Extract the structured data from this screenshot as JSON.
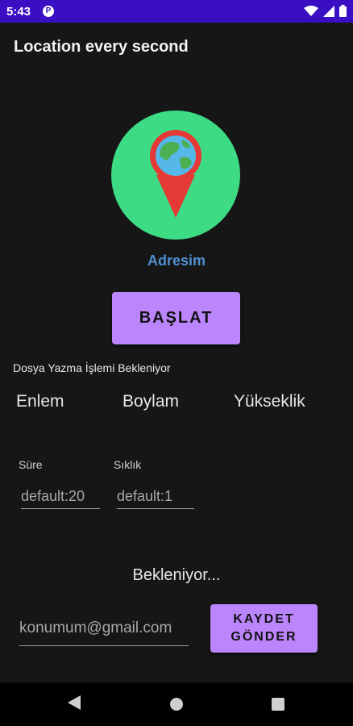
{
  "status_bar": {
    "time": "5:43",
    "app_icon_glyph": "P",
    "icons": [
      "wifi-icon",
      "signal-icon",
      "battery-icon"
    ],
    "background": "#3a0fc4"
  },
  "app_bar": {
    "title": "Location every second"
  },
  "logo": {
    "icon": "globe-map-pin-icon",
    "circle_color": "#3ddc84",
    "pin_color": "#e53935"
  },
  "address_label": "Adresim",
  "start_button": {
    "label": "BAŞLAT"
  },
  "file_status": "Dosya Yazma İşlemi Bekleniyor",
  "columns": {
    "latitude": "Enlem",
    "longitude": "Boylam",
    "altitude": "Yükseklik"
  },
  "duration": {
    "label": "Süre",
    "placeholder": "default:20"
  },
  "frequency": {
    "label": "Sıklık",
    "placeholder": "default:1"
  },
  "waiting_status": "Bekleniyor...",
  "email": {
    "placeholder": "konumum@gmail.com"
  },
  "save_button": {
    "line1": "KAYDET",
    "line2": "GÖNDER"
  },
  "accent_color": "#bb86fc",
  "nav_bar": {
    "buttons": [
      "back-icon",
      "home-icon",
      "recents-icon"
    ]
  }
}
